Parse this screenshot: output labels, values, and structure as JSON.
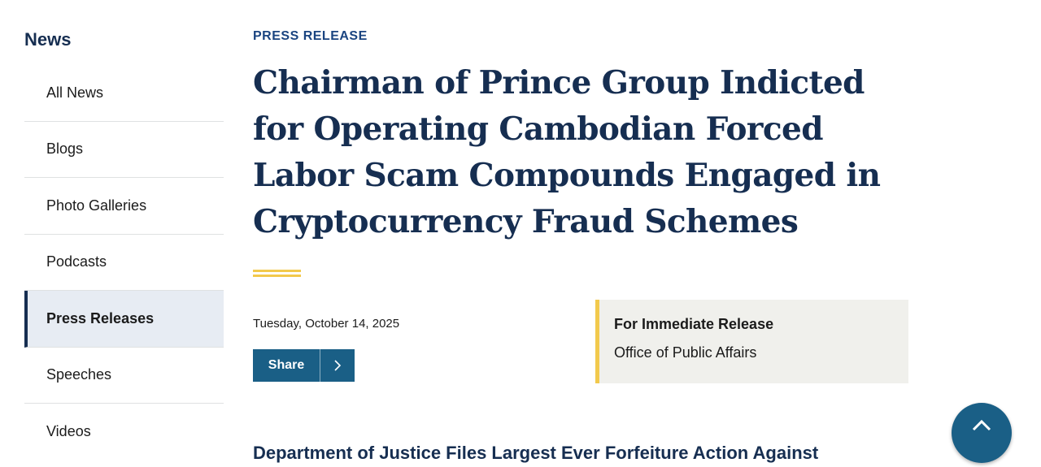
{
  "sidebar": {
    "heading": "News",
    "items": [
      {
        "label": "All News"
      },
      {
        "label": "Blogs"
      },
      {
        "label": "Photo Galleries"
      },
      {
        "label": "Podcasts"
      },
      {
        "label": "Press Releases",
        "active": true
      },
      {
        "label": "Speeches"
      },
      {
        "label": "Videos"
      }
    ]
  },
  "article": {
    "eyebrow": "PRESS RELEASE",
    "title": "Chairman of Prince Group Indicted for Operating Cambodian Forced Labor Scam Compounds Engaged in Cryptocurrency Fraud Schemes",
    "date": "Tuesday, October 14, 2025",
    "share_label": "Share",
    "share_icon": "chevron-right-icon",
    "release": {
      "heading": "For Immediate Release",
      "office": "Office of Public Affairs"
    },
    "subheading": "Department of Justice Files Largest Ever Forfeiture Action Against"
  },
  "back_to_top": {
    "icon": "chevron-up-icon"
  },
  "colors": {
    "navy": "#162e51",
    "blue": "#1a5f86",
    "gold": "#f2c94c",
    "active_bg": "#e7ecf3",
    "box_bg": "#f0f0ec"
  }
}
